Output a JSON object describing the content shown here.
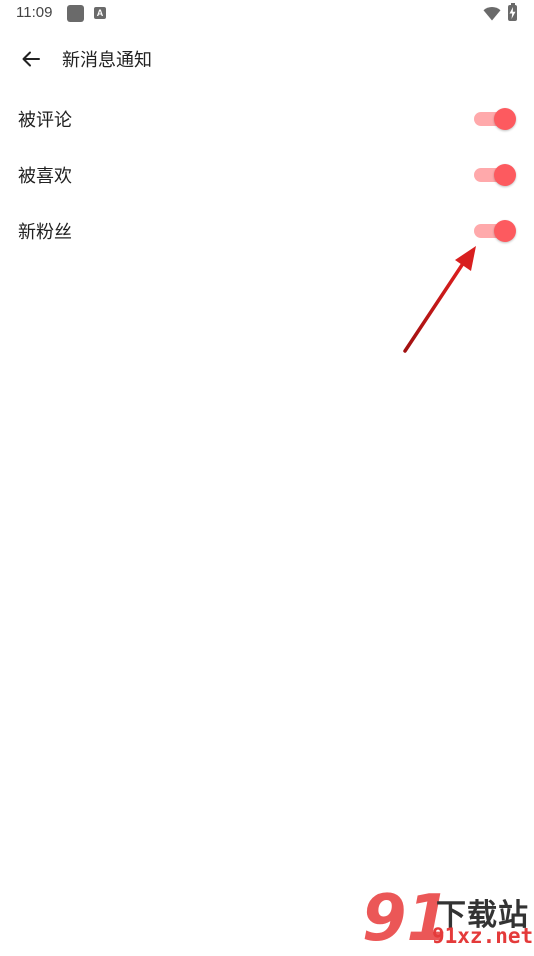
{
  "status_bar": {
    "time": "11:09",
    "notification_icon": "square-icon",
    "keyboard_icon_letter": "A",
    "icons": [
      "wifi-icon",
      "battery-charging-icon"
    ]
  },
  "toolbar": {
    "back_icon": "arrow-left-icon",
    "title": "新消息通知"
  },
  "settings": [
    {
      "label": "被评论",
      "enabled": true
    },
    {
      "label": "被喜欢",
      "enabled": true
    },
    {
      "label": "新粉丝",
      "enabled": true
    }
  ],
  "annotation": {
    "type": "arrow",
    "color": "#d81f1f",
    "points_to": "新粉丝 switch"
  },
  "watermark": {
    "logo_digits": "91",
    "brand_text": "下载站",
    "url": "91xz.net"
  },
  "colors": {
    "switch_thumb": "#fd5a5f",
    "switch_track": "#ffa9ab",
    "background": "#ffffff"
  }
}
